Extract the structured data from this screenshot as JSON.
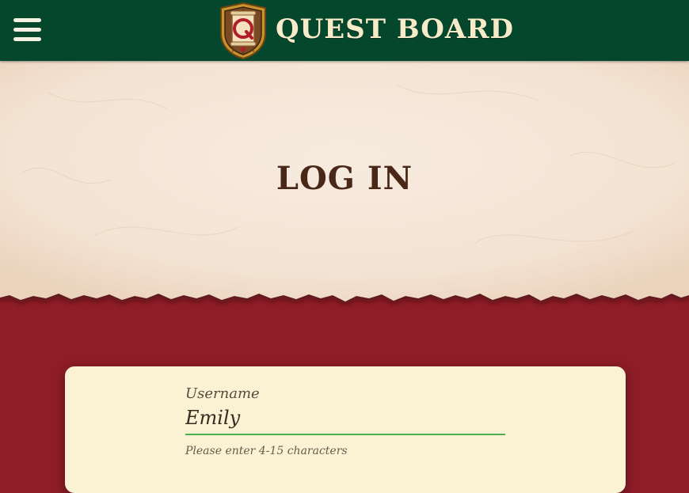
{
  "header": {
    "brand_title": "QUEST BOARD",
    "logo_letter": "Q",
    "menu_icon": "hamburger-menu-icon"
  },
  "page": {
    "title": "LOG IN"
  },
  "login_form": {
    "username_label": "Username",
    "username_value": "Emily",
    "username_hint": "Please enter 4-15 characters"
  },
  "colors": {
    "header_bg": "#04472d",
    "parchment": "#f5e6d6",
    "crimson_bg": "#8f1d28",
    "card_bg": "#fbf1d3",
    "title_brown": "#4a2818",
    "input_underline_valid": "#4caf50"
  }
}
